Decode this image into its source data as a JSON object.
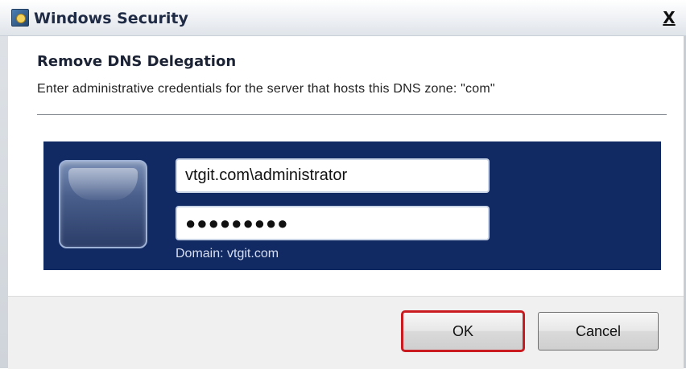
{
  "window": {
    "title": "Windows Security",
    "close_label": "X"
  },
  "dialog": {
    "heading": "Remove DNS Delegation",
    "description": "Enter administrative credentials for the server that hosts this DNS zone: \"com\""
  },
  "credentials": {
    "username": "vtgit.com\\administrator",
    "password_masked": "●●●●●●●●●",
    "domain_label": "Domain: vtgit.com"
  },
  "buttons": {
    "ok": "OK",
    "cancel": "Cancel"
  },
  "colors": {
    "credential_tile_bg": "#112a63",
    "ok_highlight": "#c91b20"
  },
  "icons": {
    "title_icon": "security-shield-icon",
    "user_tile": "user-avatar-icon"
  }
}
